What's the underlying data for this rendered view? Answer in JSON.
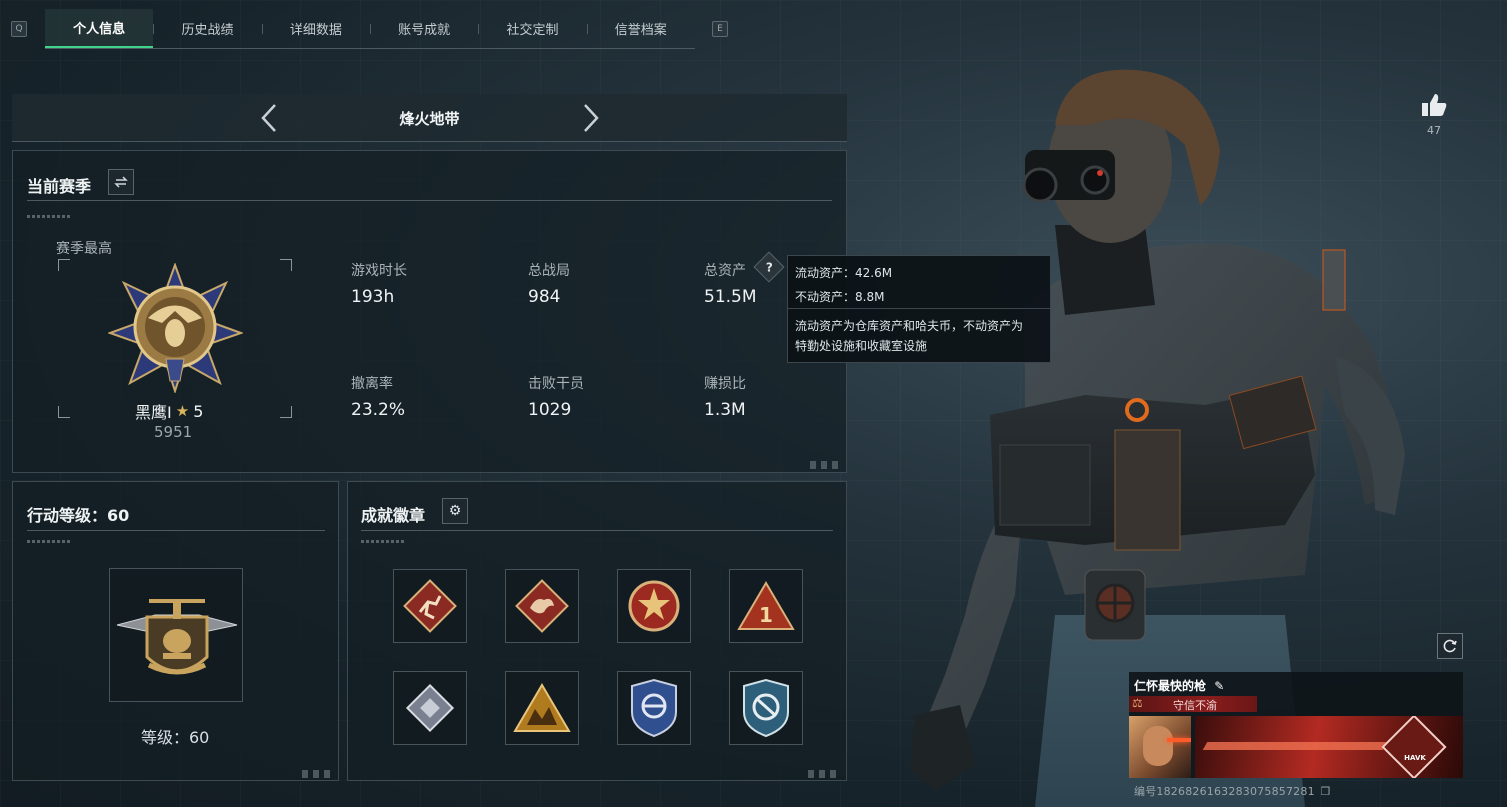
{
  "tabs": {
    "left_key": "Q",
    "right_key": "E",
    "items": [
      "个人信息",
      "历史战绩",
      "详细数据",
      "账号成就",
      "社交定制",
      "信誉档案"
    ],
    "active_index": 0
  },
  "mode": {
    "title": "烽火地带"
  },
  "season": {
    "title": "当前赛季",
    "highest_label": "赛季最高",
    "rank_name": "黑鹰I",
    "rank_stars": "5",
    "rank_score": "5951",
    "stats": [
      {
        "label": "游戏时长",
        "value": "193h"
      },
      {
        "label": "总战局",
        "value": "984"
      },
      {
        "label": "总资产",
        "value": "51.5M"
      },
      {
        "label": "撤离率",
        "value": "23.2%"
      },
      {
        "label": "击败干员",
        "value": "1029"
      },
      {
        "label": "赚损比",
        "value": "1.3M"
      }
    ]
  },
  "tooltip": {
    "liquid": "流动资产：42.6M",
    "fixed": "不动资产：8.8M",
    "desc_line1": "流动资产为仓库资产和哈夫币，不动资产为",
    "desc_line2": "特勤处设施和收藏室设施"
  },
  "action_level": {
    "title": "行动等级：60",
    "level_text": "等级：60"
  },
  "badges": {
    "title": "成就徽章",
    "items": [
      {
        "icon": "runner-badge-icon",
        "color": "#8a2a22"
      },
      {
        "icon": "dragon-badge-icon",
        "color": "#8a2a22"
      },
      {
        "icon": "star-emblem-badge-icon",
        "color": "#9c2a20"
      },
      {
        "icon": "number-one-badge-icon",
        "color": "#a3321f"
      },
      {
        "icon": "silver-diamond-badge-icon",
        "color": "#7a8090"
      },
      {
        "icon": "gold-triangle-badge-icon",
        "color": "#b07a1e"
      },
      {
        "icon": "blue-shield-badge-icon",
        "color": "#2f4f8f"
      },
      {
        "icon": "teal-shield-badge-icon",
        "color": "#2e5f7a"
      }
    ]
  },
  "likes": {
    "count": "47"
  },
  "player": {
    "name": "仁怀最快的枪",
    "reputation": "守信不渝",
    "id_text": "编号1826826163283075857281",
    "card_brand": "HAVK"
  },
  "colors": {
    "accent": "#3fd48a",
    "danger": "#b32a22"
  }
}
